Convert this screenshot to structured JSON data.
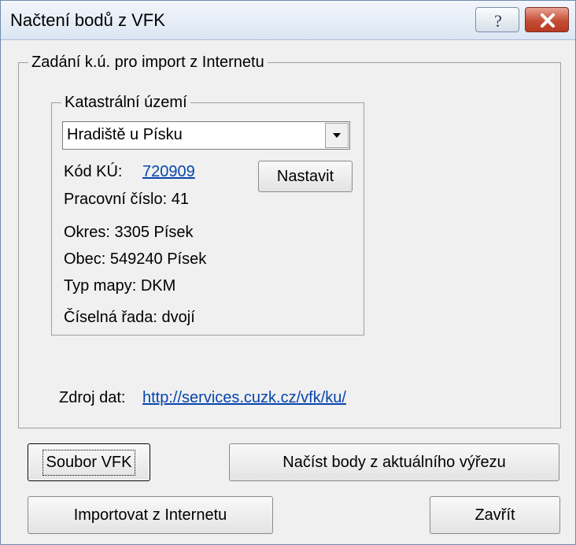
{
  "window": {
    "title": "Načtení bodů z VFK"
  },
  "import_group": {
    "legend": "Zadání k.ú. pro import z Internetu",
    "cadastral": {
      "legend": "Katastrální území",
      "selected": "Hradiště u Písku",
      "kod_label": "Kód KÚ:",
      "kod_value": "720909",
      "set_button": "Nastavit",
      "pracovni_cislo": "Pracovní číslo:  41",
      "okres": "Okres:   3305 Písek",
      "obec": "Obec:  549240 Písek",
      "typ_mapy": "Typ mapy:  DKM",
      "ciselna_rada": "Číselná řada:  dvojí"
    },
    "source_label": "Zdroj dat:",
    "source_url": "http://services.cuzk.cz/vfk/ku/"
  },
  "buttons": {
    "vfk_file": "Soubor VFK",
    "load_current_view": "Načíst body z aktuálního výřezu",
    "import_internet": "Importovat z Internetu",
    "close": "Zavřít"
  }
}
